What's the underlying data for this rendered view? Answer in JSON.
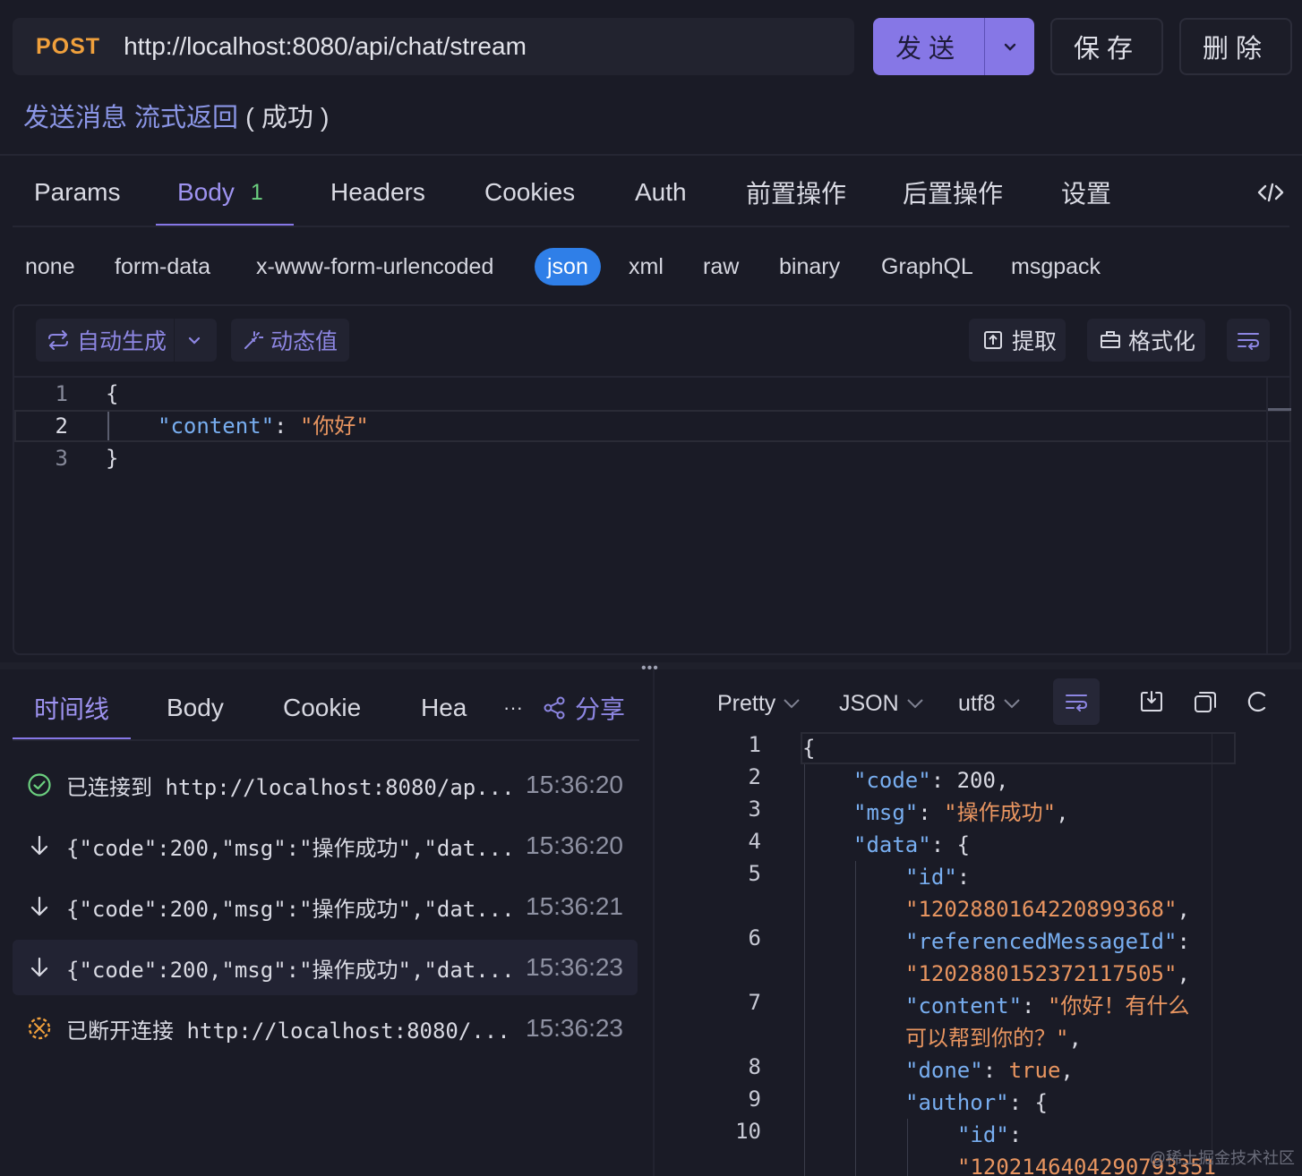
{
  "request": {
    "method": "POST",
    "url": "http://localhost:8080/api/chat/stream",
    "send_label": "发送",
    "save_label": "保存",
    "delete_label": "删除",
    "title": "发送消息 流式返回",
    "status": "( 成功 )"
  },
  "req_tabs": [
    {
      "label": "Params"
    },
    {
      "label": "Body",
      "badge": "1"
    },
    {
      "label": "Headers"
    },
    {
      "label": "Cookies"
    },
    {
      "label": "Auth"
    },
    {
      "label": "前置操作"
    },
    {
      "label": "后置操作"
    },
    {
      "label": "设置"
    }
  ],
  "body_types": [
    "none",
    "form-data",
    "x-www-form-urlencoded",
    "json",
    "xml",
    "raw",
    "binary",
    "GraphQL",
    "msgpack"
  ],
  "body_type_selected": "json",
  "editor": {
    "auto_generate": "自动生成",
    "dynamic_value": "动态值",
    "extract": "提取",
    "format": "格式化",
    "lines": [
      {
        "n": "1",
        "text": "{"
      },
      {
        "n": "2",
        "key": "\"content\"",
        "colon": ": ",
        "value": "\"你好\""
      },
      {
        "n": "3",
        "text": "}"
      }
    ]
  },
  "response": {
    "tabs": [
      "时间线",
      "Body",
      "Cookie",
      "Hea"
    ],
    "more": "···",
    "share": "分享",
    "timeline": [
      {
        "icon": "check-circle-icon",
        "text": "已连接到 http://localhost:8080/ap...",
        "time": "15:36:20"
      },
      {
        "icon": "arrow-down-icon",
        "text": "{\"code\":200,\"msg\":\"操作成功\",\"dat...",
        "time": "15:36:20"
      },
      {
        "icon": "arrow-down-icon",
        "text": "{\"code\":200,\"msg\":\"操作成功\",\"dat...",
        "time": "15:36:21"
      },
      {
        "icon": "arrow-down-icon",
        "text": "{\"code\":200,\"msg\":\"操作成功\",\"dat...",
        "time": "15:36:23"
      },
      {
        "icon": "disconnect-icon",
        "text": "已断开连接 http://localhost:8080/...",
        "time": "15:36:23"
      }
    ],
    "view_mode": "Pretty",
    "format": "JSON",
    "encoding": "utf8",
    "body_lines": {
      "l1": "{",
      "l2k": "\"code\"",
      "l2v": "200",
      "l3k": "\"msg\"",
      "l3v": "\"操作成功\"",
      "l4k": "\"data\"",
      "l4v": "{",
      "l5k": "\"id\"",
      "l5v": "\"1202880164220899368\"",
      "l6k": "\"referencedMessageId\"",
      "l6v": "\"1202880152372117505\"",
      "l7k": "\"content\"",
      "l7v1": "\"你好！有什么",
      "l7v2": "可以帮到你的？\"",
      "l8k": "\"done\"",
      "l8v": "true",
      "l9k": "\"author\"",
      "l9v": "{",
      "l10k": "\"id\"",
      "l10v": "\"1202146404290793351"
    },
    "line_numbers": [
      "1",
      "2",
      "3",
      "4",
      "5",
      "6",
      "7",
      "8",
      "9",
      "10"
    ]
  },
  "watermark": "@稀土掘金技术社区",
  "colors": {
    "accent": "#8677e6",
    "json_badge": "#2f7fe8",
    "method": "#f0a03c",
    "success": "#6bcf7f"
  }
}
